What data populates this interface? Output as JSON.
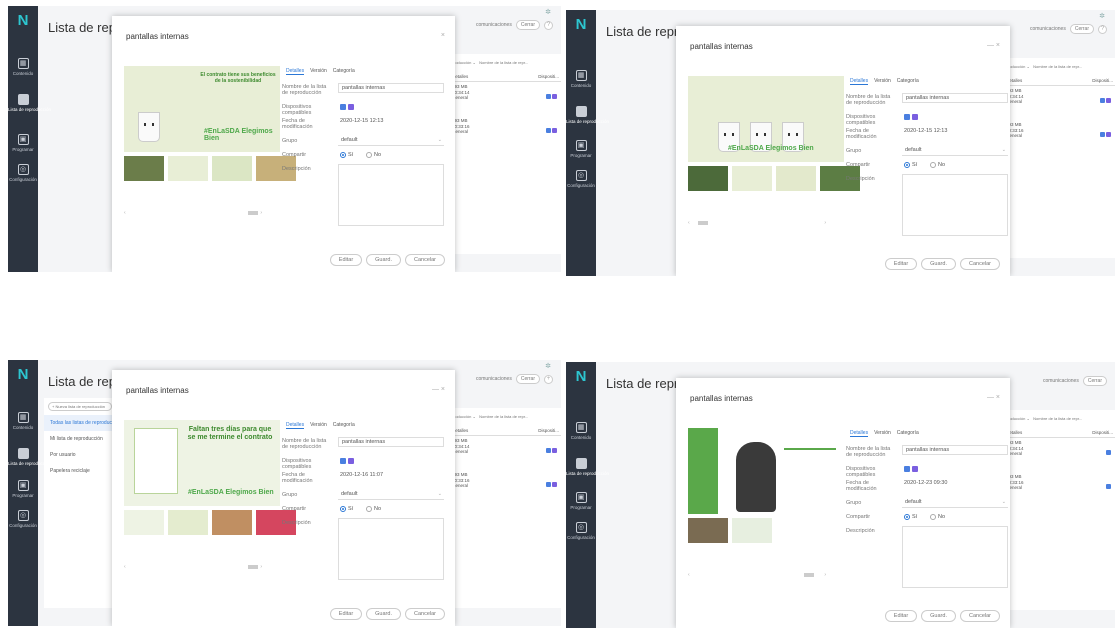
{
  "app": {
    "title": "Lista de reproducción",
    "title_truncated": "Lista de reprod",
    "logo": "N",
    "topbar": {
      "notifications_label": "comunicaciones",
      "close_label": "Cerrar"
    }
  },
  "sidebar": {
    "items": [
      {
        "label": "Contenido",
        "icon": "grid-icon"
      },
      {
        "label": "Lista de reproducción",
        "icon": "playlist-icon",
        "active": true
      },
      {
        "label": "Programar",
        "icon": "calendar-icon"
      },
      {
        "label": "Configuración",
        "icon": "settings-icon"
      }
    ]
  },
  "left_panel": {
    "new_button": "+ Nueva lista de reproducción",
    "items": [
      {
        "label": "Todas las listas de reproducción",
        "active": true
      },
      {
        "label": "Mi lista de reproducción"
      },
      {
        "label": "Por usuario"
      },
      {
        "label": "Papelera reciclaje"
      }
    ]
  },
  "bg_table": {
    "filter_label": "...oducción ⌄",
    "search_placeholder": "Nombre de la lista de repr...",
    "col_details": "Detalles",
    "col_devices": "Dispositi...",
    "rows": [
      {
        "size": "993 MB",
        "duration": "00:34:14",
        "group": "General"
      },
      {
        "size": "993 MB",
        "duration": "00:33:16",
        "group": "General"
      }
    ]
  },
  "dialog": {
    "title": "pantallas internas",
    "controls": "— ×",
    "tabs": [
      "Detalles",
      "Versión",
      "Categoría"
    ],
    "labels": {
      "name": "Nombre de la lista de reproducción",
      "devices": "Dispositivos compatibles",
      "modified": "Fecha de modificación",
      "group": "Grupo",
      "share": "Compartir",
      "description": "Descripción"
    },
    "name_value": "pantallas internas",
    "group_value": "default",
    "share_yes": "Sí",
    "share_no": "No",
    "buttons": {
      "edit": "Editar",
      "save": "Guard.",
      "cancel": "Cancelar"
    }
  },
  "screens": [
    {
      "modified": "2020-12-15 12:13",
      "preview_title": "El contrato tiene sus beneficios de la sostenibilidad",
      "preview_hashtag": "#EnLaSDA Elegimos Bien"
    },
    {
      "modified": "2020-12-15 12:13",
      "preview_title": "",
      "preview_hashtag": "#EnLaSDA Elegimos Bien"
    },
    {
      "modified": "2020-12-16 11:07",
      "preview_title": "Faltan tres días para que se me termine el contrato",
      "preview_hashtag": "#EnLaSDA Elegimos Bien"
    },
    {
      "modified": "2020-12-23 09:30",
      "preview_title": "",
      "preview_hashtag": ""
    }
  ],
  "colors": {
    "sidebar": "#2c3440",
    "accent": "#2b77d6",
    "logo": "#2dc6d0",
    "tag_blue": "#4a7fe0",
    "tag_purple": "#7a5fe0"
  }
}
